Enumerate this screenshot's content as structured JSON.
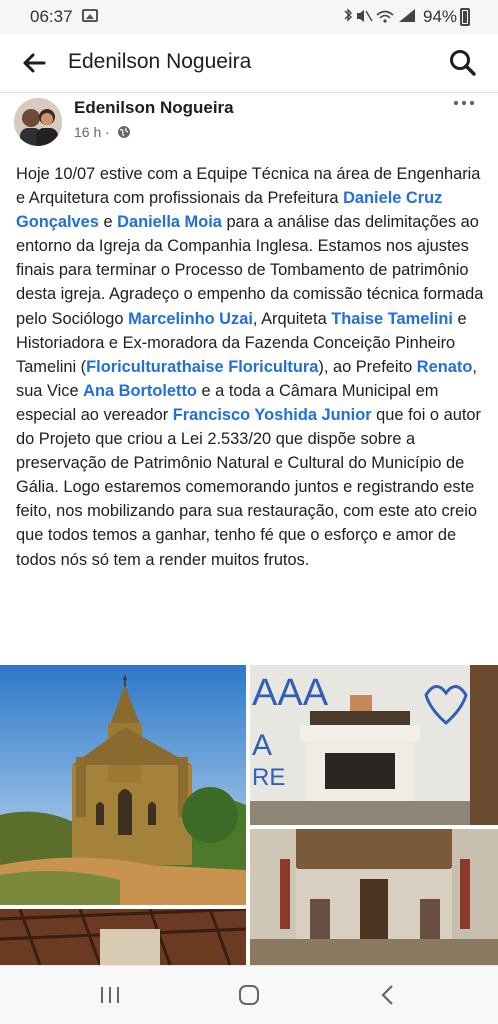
{
  "status_bar": {
    "time": "06:37",
    "battery": "94%",
    "icons": [
      "gallery-icon",
      "bluetooth-icon",
      "mute-icon",
      "wifi-icon",
      "signal-icon",
      "battery-icon"
    ]
  },
  "app_bar": {
    "title": "Edenilson Nogueira",
    "back_icon": "arrow-left-icon",
    "search_icon": "search-icon"
  },
  "post": {
    "author": "Edenilson Nogueira",
    "time": "16 h ·",
    "privacy_icon": "globe-icon",
    "more_icon": "more-horizontal-icon",
    "body": [
      {
        "t": "Hoje 10/07 estive com a Equipe Técnica na área de Engenharia e Arquitetura com profissionais da Prefeitura "
      },
      {
        "t": "Daniele Cruz Gonçalves",
        "m": true
      },
      {
        "t": " e "
      },
      {
        "t": "Daniella Moia",
        "m": true
      },
      {
        "t": " para a análise das delimitações  ao entorno da Igreja da Companhia Inglesa. Estamos nos ajustes finais para terminar o Processo de Tombamento de patrimônio desta igreja. Agradeço o empenho da comissão técnica formada pelo Sociólogo "
      },
      {
        "t": "Marcelinho Uzai",
        "m": true
      },
      {
        "t": ", Arquiteta "
      },
      {
        "t": "Thaise Tamelini",
        "m": true
      },
      {
        "t": " e Historiadora e Ex-moradora da Fazenda Conceição Pinheiro Tamelini ("
      },
      {
        "t": "Floriculturathaise Floricultura",
        "m": true
      },
      {
        "t": "), ao Prefeito "
      },
      {
        "t": "Renato",
        "m": true
      },
      {
        "t": ", sua Vice "
      },
      {
        "t": "Ana Bortoletto",
        "m": true
      },
      {
        "t": " e a toda a Câmara Municipal em especial ao vereador "
      },
      {
        "t": "Francisco Yoshida Junior",
        "m": true
      },
      {
        "t": " que foi o autor do Projeto que criou a Lei 2.533/20 que dispõe sobre a preservação de Patrimônio Natural e Cultural do Município de Gália. Logo estaremos comemorando juntos e registrando este feito, nos mobilizando para sua restauração, com este ato creio que todos temos a ganhar, tenho fé que o esforço e amor de todos nós só tem a render muitos frutos."
      }
    ],
    "photos": [
      {
        "name": "photo-church-exterior"
      },
      {
        "name": "photo-altar-graffiti",
        "graffiti": "AAA A RE"
      },
      {
        "name": "photo-church-interior"
      },
      {
        "name": "photo-ruined-roof"
      }
    ]
  },
  "nav_bar": {
    "icons": [
      "recent-apps-icon",
      "home-icon",
      "back-icon"
    ]
  },
  "colors": {
    "mention": "#216fdb",
    "text": "#1c1e21",
    "meta": "#65676b"
  }
}
